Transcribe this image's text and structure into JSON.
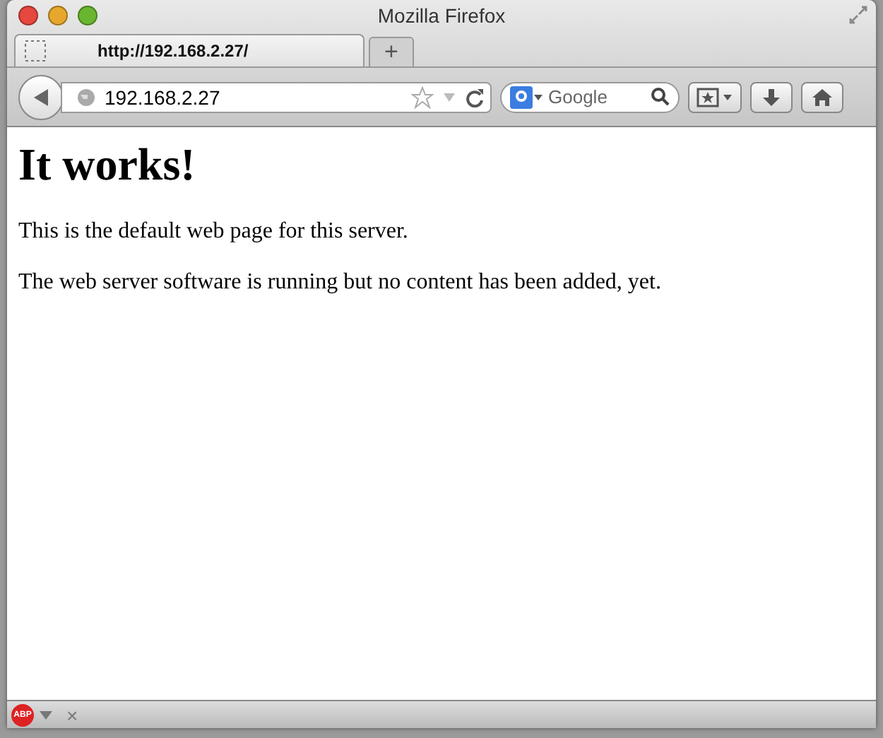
{
  "window": {
    "title": "Mozilla Firefox"
  },
  "tabs": [
    {
      "label": "http://192.168.2.27/",
      "selected": true
    }
  ],
  "new_tab": "+",
  "toolbar": {
    "url": "192.168.2.27",
    "search_placeholder": "Google"
  },
  "page": {
    "heading": "It works!",
    "paragraphs": [
      "This is the default web page for this server.",
      "The web server software is running but no content has been added, yet."
    ]
  },
  "addon_bar": {
    "badge": "ABP",
    "close": "×"
  }
}
